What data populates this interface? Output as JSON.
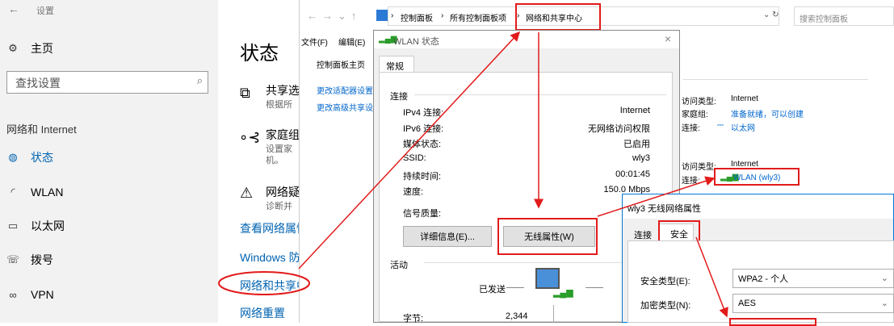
{
  "settings": {
    "back_label": "设置",
    "home": "主页",
    "search_placeholder": "查找设置",
    "section": "网络和 Internet",
    "nav": [
      {
        "label": "状态",
        "icon": "globe-icon"
      },
      {
        "label": "WLAN",
        "icon": "wifi-icon"
      },
      {
        "label": "以太网",
        "icon": "ethernet-icon"
      },
      {
        "label": "拨号",
        "icon": "dialup-icon"
      },
      {
        "label": "VPN",
        "icon": "vpn-icon"
      }
    ],
    "page_title": "状态",
    "items": [
      {
        "title": "共享选",
        "sub": "根据所",
        "icon": "share-icon"
      },
      {
        "title": "家庭组",
        "sub": "设置家",
        "sub2": "机。",
        "icon": "homegroup-icon"
      },
      {
        "title": "网络疑",
        "sub": "诊断并",
        "icon": "warning-icon"
      }
    ],
    "links": [
      "查看网络属性",
      "Windows 防",
      "网络和共享中",
      "网络重置"
    ]
  },
  "control_panel": {
    "breadcrumb": [
      "控制面板",
      "所有控制面板项",
      "网络和共享中心"
    ],
    "search_placeholder": "搜索控制面板",
    "menu": [
      "文件(F)",
      "编辑(E)"
    ],
    "left_links": [
      "控制面板主页",
      "更改适配器设置",
      "更改高级共享设"
    ],
    "right_info": {
      "row1_label": "访问类型:",
      "row1_value": "Internet",
      "row2_label": "家庭组:",
      "row2_value": "准备就绪，可以创建",
      "row3_label": "连接:",
      "row3_value": "以太网",
      "row4_label": "访问类型:",
      "row4_value": "Internet",
      "row5_label": "连接:",
      "row5_value": "WLAN (wly3)"
    }
  },
  "wlan_status": {
    "title": "WLAN 状态",
    "tab": "常规",
    "group_connect": "连接",
    "rows": [
      {
        "label": "IPv4 连接:",
        "value": "Internet"
      },
      {
        "label": "IPv6 连接:",
        "value": "无网络访问权限"
      },
      {
        "label": "媒体状态:",
        "value": "已启用"
      },
      {
        "label": "SSID:",
        "value": "wly3"
      },
      {
        "label": "持续时间:",
        "value": "00:01:45"
      },
      {
        "label": "速度:",
        "value": "150.0 Mbps"
      }
    ],
    "signal_label": "信号质量:",
    "details_button": "详细信息(E)...",
    "wireless_button": "无线属性(W)",
    "group_activity": "活动",
    "sent_label": "已发送",
    "bytes_label": "字节:",
    "bytes_sent": "2,344"
  },
  "wireless_props": {
    "title": "wly3 无线网络属性",
    "tabs": [
      "连接",
      "安全"
    ],
    "security_type_label": "安全类型(E):",
    "security_type_value": "WPA2 - 个人",
    "encryption_label": "加密类型(N):",
    "encryption_value": "AES"
  },
  "colors": {
    "accent": "#0063b1",
    "annotation": "#e21b1b",
    "link": "#0066cc"
  }
}
